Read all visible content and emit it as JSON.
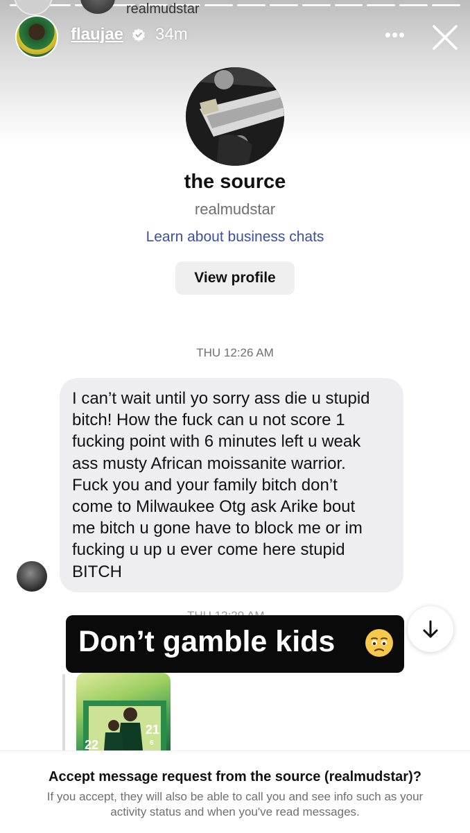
{
  "story": {
    "top_username": "realmudstar",
    "username": "flaujae",
    "time": "34m",
    "more_label": "•••"
  },
  "profile": {
    "name": "the source",
    "handle": "realmudstar",
    "business_link": "Learn about business chats",
    "view_profile_label": "View profile"
  },
  "messages": {
    "timestamp": "THU 12:26 AM",
    "text": "I can’t wait until yo sorry ass die u stupid\nbitch! How the fuck can u not score 1\nfucking point with 6 minutes left u weak\nass musty African moissanite warrior.\nFuck you and your family bitch don’t\ncome to Milwaukee Otg ask Arike bout\nme bitch u gone have to block me or im\nfucking u up u ever come here stupid\nBITCH",
    "hidden_timestamp": "THU 12:29 AM"
  },
  "sticker": {
    "text": "Don’t gamble kids"
  },
  "shared_post": {
    "numbers": [
      "21",
      "6",
      "22"
    ]
  },
  "request": {
    "title": "Accept message request from the source (realmudstar)?",
    "body": "If you accept, they will also be able to call you and see info such as your activity status and when you've read messages."
  },
  "colors": {
    "link": "#3b4fa5",
    "bubble": "#eeeef0",
    "sticker_bg": "#0a0a0a"
  }
}
